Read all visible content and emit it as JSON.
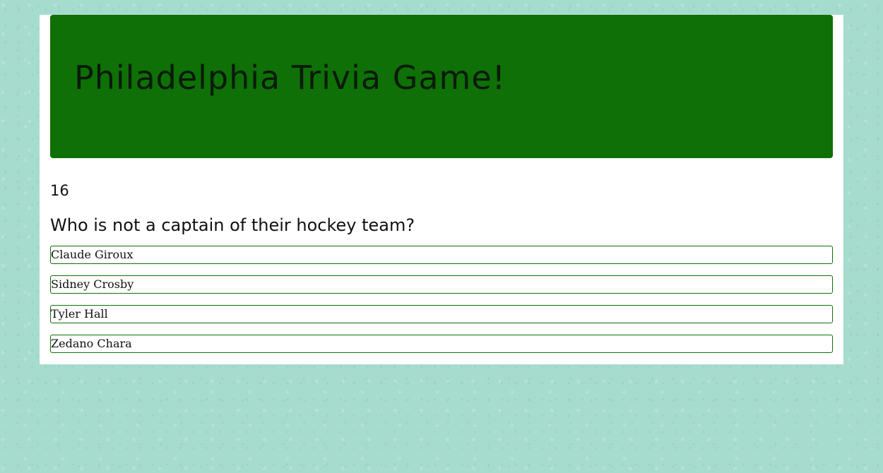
{
  "header": {
    "title": "Philadelphia Trivia Game!"
  },
  "question": {
    "counter": "16",
    "text": "Who is not a captain of their hockey team?",
    "answers": [
      "Claude Giroux",
      "Sidney Crosby",
      "Tyler Hall",
      "Zedano Chara"
    ]
  },
  "colors": {
    "background": "#a6dccd",
    "header_green": "#0e7006",
    "answer_border": "#0e7006"
  }
}
